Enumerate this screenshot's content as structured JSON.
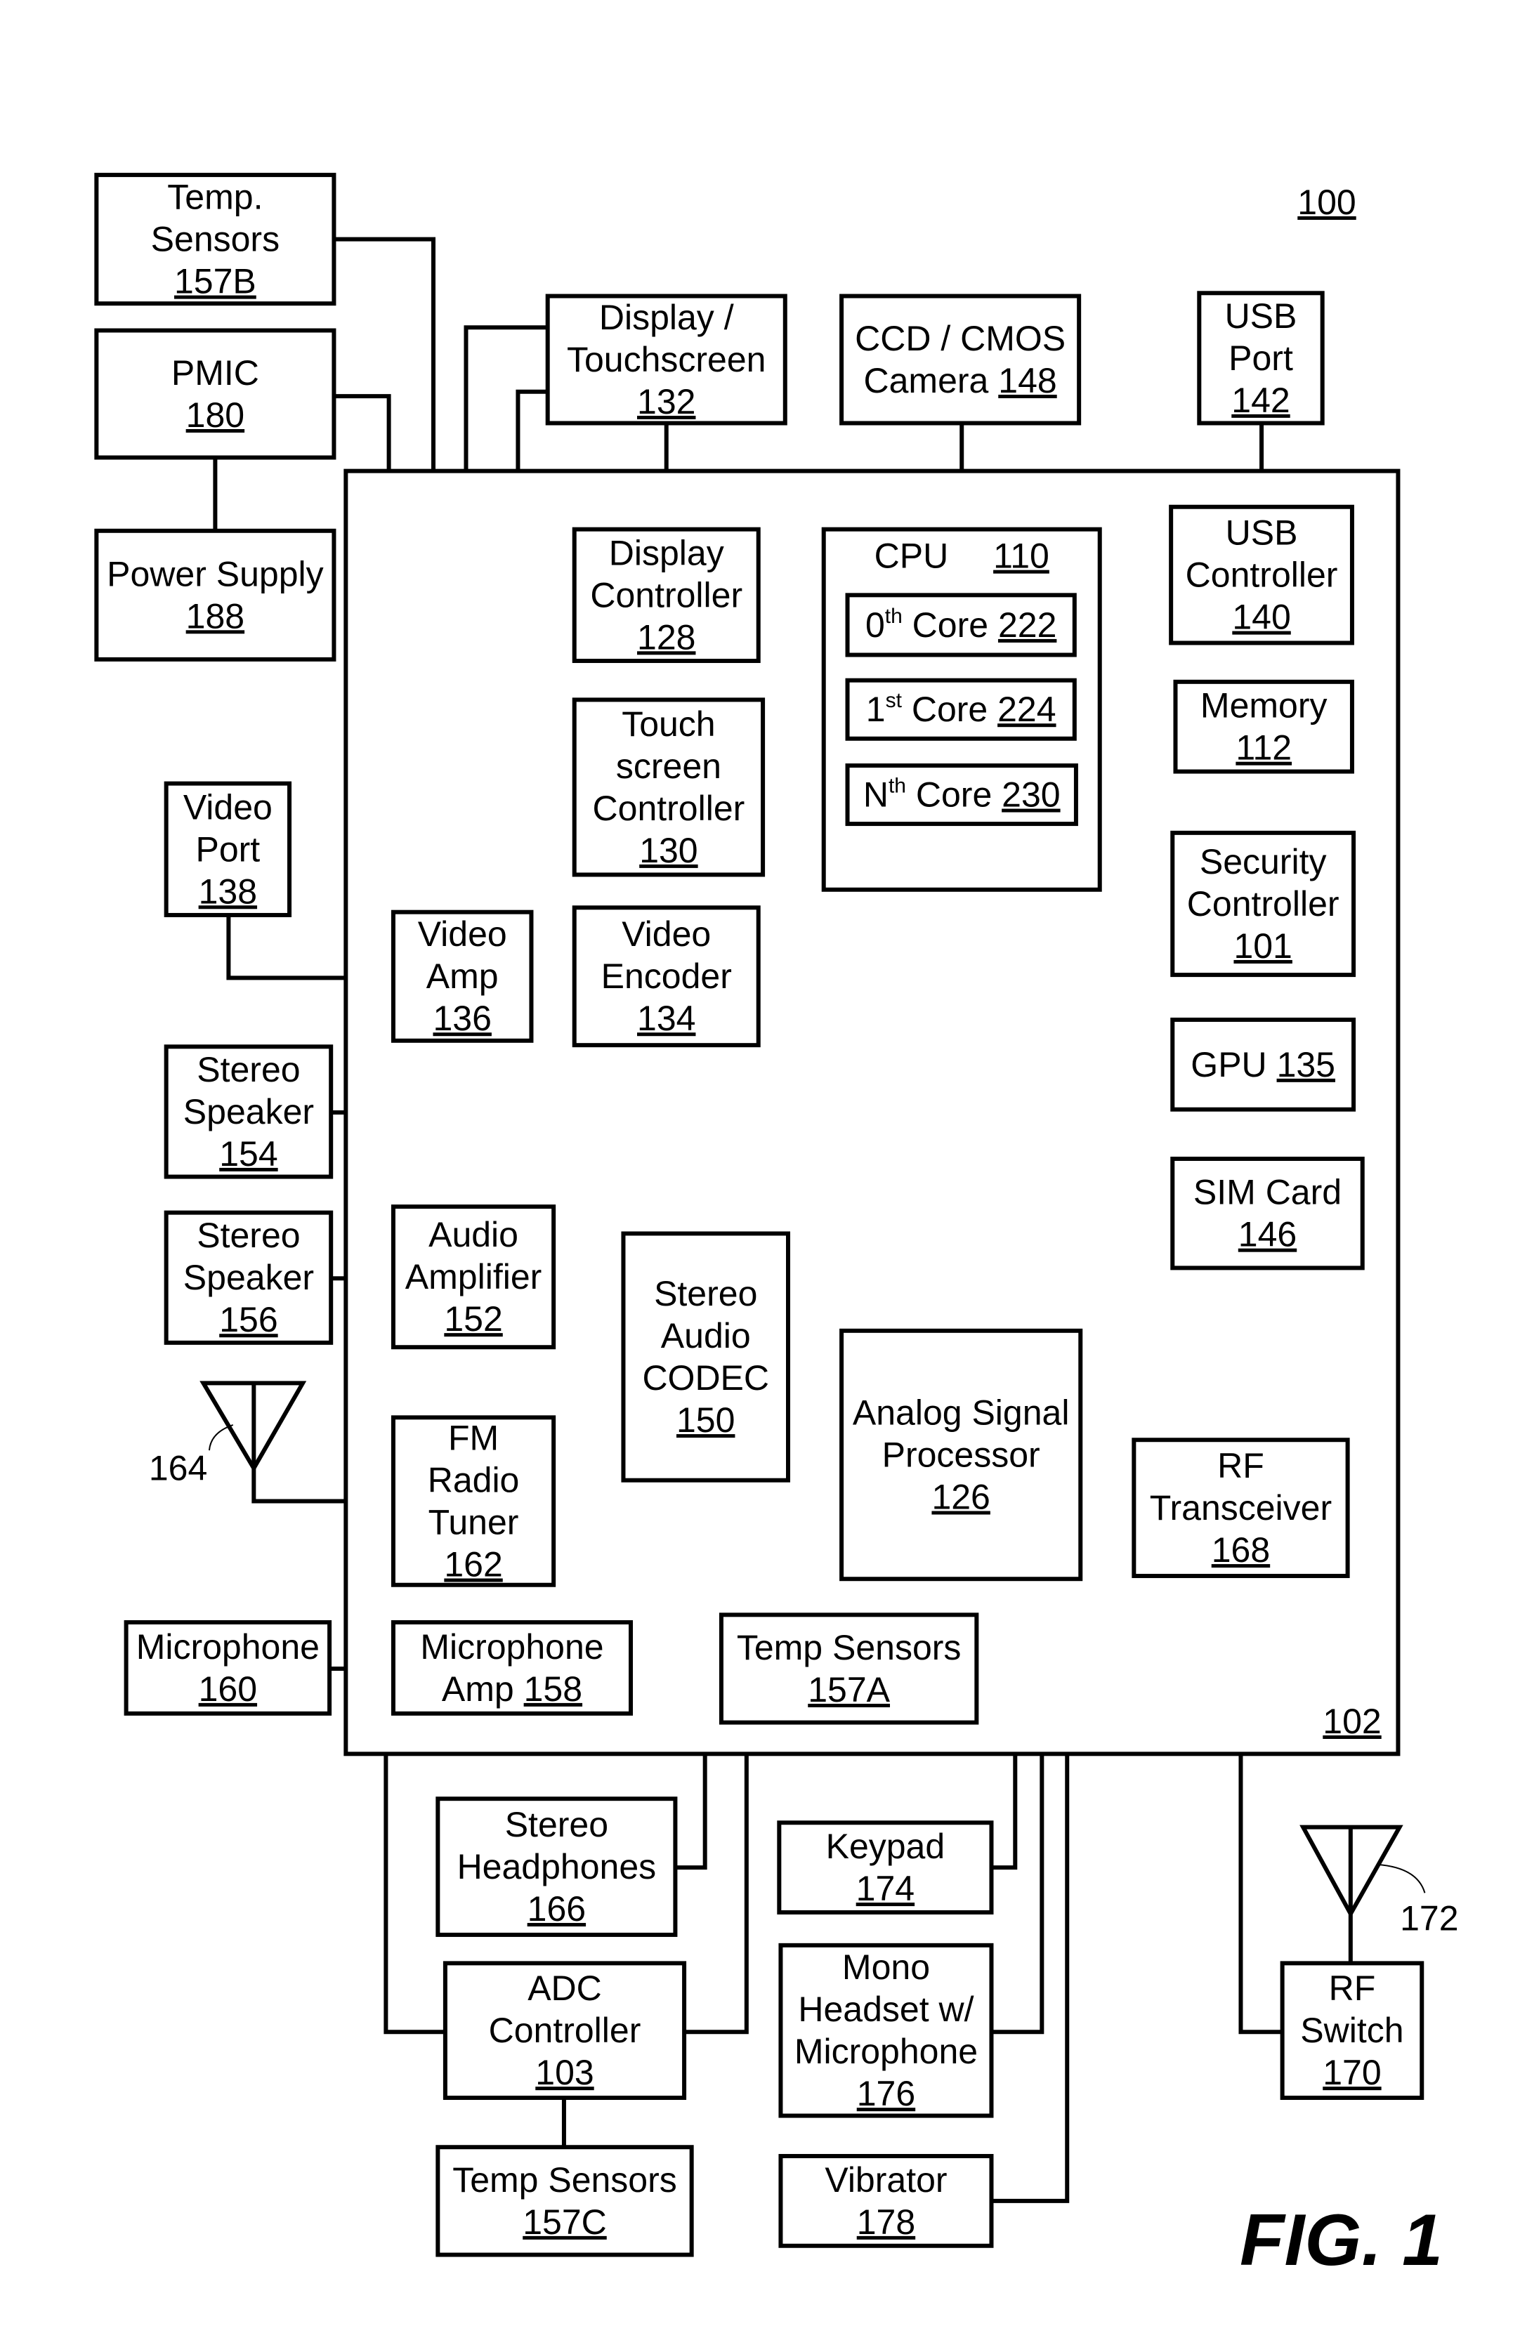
{
  "figure": {
    "label": "FIG. 1",
    "device_ref": "100",
    "chip_ref": "102"
  },
  "blocks": {
    "temp_sensors_157b": {
      "lines": [
        "Temp.",
        "Sensors"
      ],
      "ref": "157B"
    },
    "pmic": {
      "lines": [
        "PMIC"
      ],
      "ref": "180"
    },
    "power_supply": {
      "lines": [
        "Power Supply"
      ],
      "ref": "188"
    },
    "display_touchscreen": {
      "lines": [
        "Display /",
        "Touchscreen"
      ],
      "ref": "132"
    },
    "camera": {
      "lines": [
        "CCD / CMOS",
        "Camera"
      ],
      "ref": "148"
    },
    "usb_port": {
      "lines": [
        "USB",
        "Port"
      ],
      "ref": "142"
    },
    "display_controller": {
      "lines": [
        "Display",
        "Controller"
      ],
      "ref": "128"
    },
    "cpu": {
      "lines": [
        "CPU"
      ],
      "ref": "110"
    },
    "core_0": {
      "prefix": "0",
      "sup": "th",
      "text": "Core",
      "ref": "222"
    },
    "core_1": {
      "prefix": "1",
      "sup": "st",
      "text": "Core",
      "ref": "224"
    },
    "core_n": {
      "prefix": "N",
      "sup": "th",
      "text": "Core",
      "ref": "230"
    },
    "usb_controller": {
      "lines": [
        "USB",
        "Controller"
      ],
      "ref": "140"
    },
    "memory": {
      "lines": [
        "Memory"
      ],
      "ref": "112"
    },
    "security_controller": {
      "lines": [
        "Security",
        "Controller"
      ],
      "ref": "101"
    },
    "gpu": {
      "lines": [
        "GPU"
      ],
      "ref": "135"
    },
    "touchscreen_controller": {
      "lines": [
        "Touch",
        "screen",
        "Controller"
      ],
      "ref": "130"
    },
    "video_port": {
      "lines": [
        "Video",
        "Port"
      ],
      "ref": "138"
    },
    "video_amp": {
      "lines": [
        "Video",
        "Amp"
      ],
      "ref": "136"
    },
    "video_encoder": {
      "lines": [
        "Video",
        "Encoder"
      ],
      "ref": "134"
    },
    "stereo_speaker_154": {
      "lines": [
        "Stereo",
        "Speaker"
      ],
      "ref": "154"
    },
    "stereo_speaker_156": {
      "lines": [
        "Stereo",
        "Speaker"
      ],
      "ref": "156"
    },
    "audio_amplifier": {
      "lines": [
        "Audio",
        "Amplifier"
      ],
      "ref": "152"
    },
    "stereo_audio_codec": {
      "lines": [
        "Stereo",
        "Audio",
        "CODEC"
      ],
      "ref": "150"
    },
    "sim_card": {
      "lines": [
        "SIM Card"
      ],
      "ref": "146"
    },
    "analog_signal_processor": {
      "lines": [
        "Analog Signal",
        "Processor"
      ],
      "ref": "126"
    },
    "rf_transceiver": {
      "lines": [
        "RF",
        "Transceiver"
      ],
      "ref": "168"
    },
    "fm_radio_tuner": {
      "lines": [
        "FM",
        "Radio",
        "Tuner"
      ],
      "ref": "162"
    },
    "microphone": {
      "lines": [
        "Microphone"
      ],
      "ref": "160"
    },
    "microphone_amp": {
      "lines": [
        "Microphone",
        "Amp"
      ],
      "ref": "158"
    },
    "temp_sensors_157a": {
      "lines": [
        "Temp Sensors"
      ],
      "ref": "157A"
    },
    "stereo_headphones": {
      "lines": [
        "Stereo",
        "Headphones"
      ],
      "ref": "166"
    },
    "keypad": {
      "lines": [
        "Keypad"
      ],
      "ref": "174"
    },
    "adc_controller": {
      "lines": [
        "ADC",
        "Controller"
      ],
      "ref": "103"
    },
    "mono_headset": {
      "lines": [
        "Mono",
        "Headset w/",
        "Microphone"
      ],
      "ref": "176"
    },
    "temp_sensors_157c": {
      "lines": [
        "Temp Sensors"
      ],
      "ref": "157C"
    },
    "vibrator": {
      "lines": [
        "Vibrator"
      ],
      "ref": "178"
    },
    "rf_switch": {
      "lines": [
        "RF",
        "Switch"
      ],
      "ref": "170"
    }
  },
  "antennas": {
    "fm_antenna": {
      "ref": "164"
    },
    "rf_antenna": {
      "ref": "172"
    }
  }
}
